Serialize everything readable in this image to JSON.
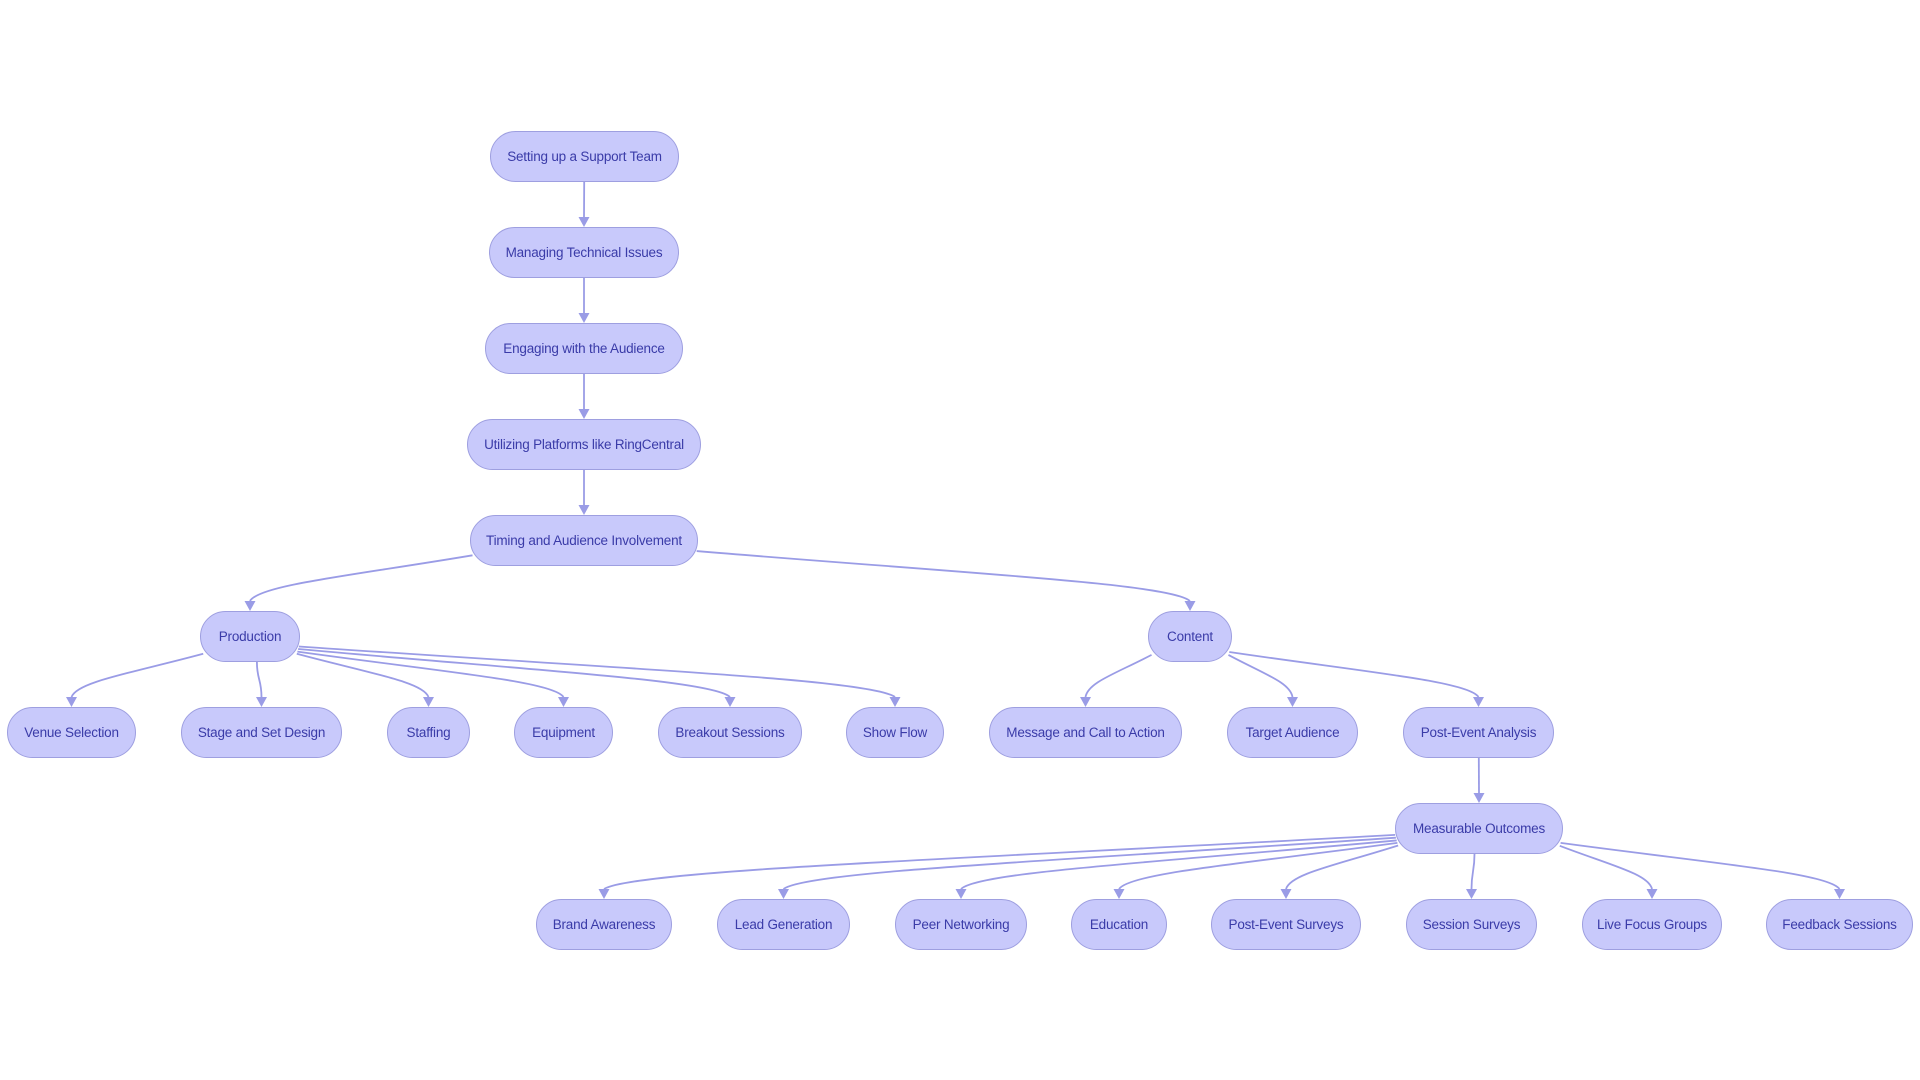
{
  "diagram": {
    "type": "flowchart",
    "direction": "top-down",
    "colors": {
      "node_fill": "#c8c9fb",
      "node_border": "#9e9fe0",
      "node_text": "#3a3ba8",
      "edge": "#9a9ce6",
      "background": "#ffffff"
    },
    "nodes": [
      {
        "id": "support_team",
        "label": "Setting up a Support Team"
      },
      {
        "id": "technical_issues",
        "label": "Managing Technical Issues"
      },
      {
        "id": "engaging_audience",
        "label": "Engaging with the Audience"
      },
      {
        "id": "platforms",
        "label": "Utilizing Platforms like RingCentral"
      },
      {
        "id": "timing",
        "label": "Timing and Audience Involvement"
      },
      {
        "id": "production",
        "label": "Production"
      },
      {
        "id": "content",
        "label": "Content"
      },
      {
        "id": "venue_selection",
        "label": "Venue Selection"
      },
      {
        "id": "stage_design",
        "label": "Stage and Set Design"
      },
      {
        "id": "staffing",
        "label": "Staffing"
      },
      {
        "id": "equipment",
        "label": "Equipment"
      },
      {
        "id": "breakout_sessions",
        "label": "Breakout Sessions"
      },
      {
        "id": "show_flow",
        "label": "Show Flow"
      },
      {
        "id": "message_cta",
        "label": "Message and Call to Action"
      },
      {
        "id": "target_audience",
        "label": "Target Audience"
      },
      {
        "id": "post_event_analysis",
        "label": "Post-Event Analysis"
      },
      {
        "id": "measurable_outcomes",
        "label": "Measurable Outcomes"
      },
      {
        "id": "brand_awareness",
        "label": "Brand Awareness"
      },
      {
        "id": "lead_generation",
        "label": "Lead Generation"
      },
      {
        "id": "peer_networking",
        "label": "Peer Networking"
      },
      {
        "id": "education",
        "label": "Education"
      },
      {
        "id": "post_event_surveys",
        "label": "Post-Event Surveys"
      },
      {
        "id": "session_surveys",
        "label": "Session Surveys"
      },
      {
        "id": "live_focus_groups",
        "label": "Live Focus Groups"
      },
      {
        "id": "feedback_sessions",
        "label": "Feedback Sessions"
      }
    ],
    "edges": [
      {
        "from": "support_team",
        "to": "technical_issues"
      },
      {
        "from": "technical_issues",
        "to": "engaging_audience"
      },
      {
        "from": "engaging_audience",
        "to": "platforms"
      },
      {
        "from": "platforms",
        "to": "timing"
      },
      {
        "from": "timing",
        "to": "production"
      },
      {
        "from": "timing",
        "to": "content"
      },
      {
        "from": "production",
        "to": "venue_selection"
      },
      {
        "from": "production",
        "to": "stage_design"
      },
      {
        "from": "production",
        "to": "staffing"
      },
      {
        "from": "production",
        "to": "equipment"
      },
      {
        "from": "production",
        "to": "breakout_sessions"
      },
      {
        "from": "production",
        "to": "show_flow"
      },
      {
        "from": "content",
        "to": "message_cta"
      },
      {
        "from": "content",
        "to": "target_audience"
      },
      {
        "from": "content",
        "to": "post_event_analysis"
      },
      {
        "from": "post_event_analysis",
        "to": "measurable_outcomes"
      },
      {
        "from": "measurable_outcomes",
        "to": "brand_awareness"
      },
      {
        "from": "measurable_outcomes",
        "to": "lead_generation"
      },
      {
        "from": "measurable_outcomes",
        "to": "peer_networking"
      },
      {
        "from": "measurable_outcomes",
        "to": "education"
      },
      {
        "from": "measurable_outcomes",
        "to": "post_event_surveys"
      },
      {
        "from": "measurable_outcomes",
        "to": "session_surveys"
      },
      {
        "from": "measurable_outcomes",
        "to": "live_focus_groups"
      },
      {
        "from": "measurable_outcomes",
        "to": "feedback_sessions"
      }
    ]
  }
}
